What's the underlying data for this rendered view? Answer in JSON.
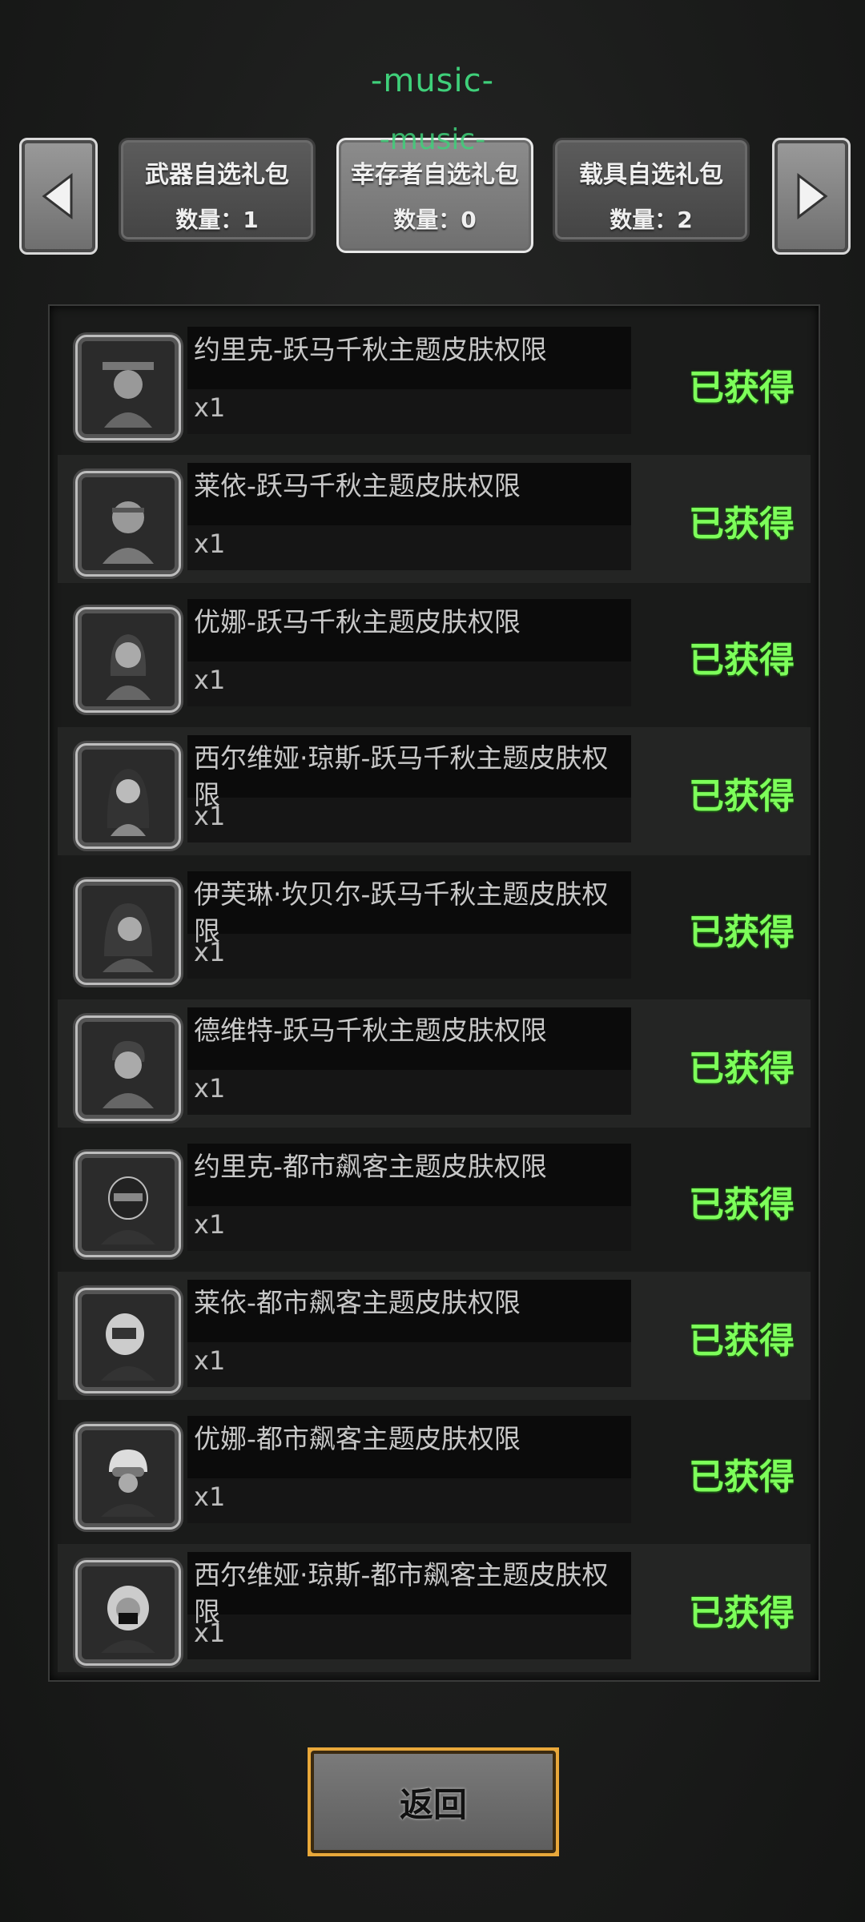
{
  "overlay": {
    "music_top": "-music-",
    "music_over": "-music-"
  },
  "tabs": [
    {
      "title": "武器自选礼包",
      "count": "数量：1"
    },
    {
      "title": "幸存者自选礼包",
      "count": "数量：0"
    },
    {
      "title": "载具自选礼包",
      "count": "数量：2"
    }
  ],
  "items": [
    {
      "name": "约里克-跃马千秋主题皮肤权限",
      "qty": "x1",
      "status": "已获得",
      "portrait": "hat-man-portrait"
    },
    {
      "name": "莱依-跃马千秋主题皮肤权限",
      "qty": "x1",
      "status": "已获得",
      "portrait": "headband-man-portrait"
    },
    {
      "name": "优娜-跃马千秋主题皮肤权限",
      "qty": "x1",
      "status": "已获得",
      "portrait": "woman-portrait"
    },
    {
      "name": "西尔维娅·琼斯-跃马千秋主题皮肤权限",
      "qty": "x1",
      "status": "已获得",
      "portrait": "long-hair-woman-portrait"
    },
    {
      "name": "伊芙琳·坎贝尔-跃马千秋主题皮肤权限",
      "qty": "x1",
      "status": "已获得",
      "portrait": "hooded-woman-portrait"
    },
    {
      "name": "德维特-跃马千秋主题皮肤权限",
      "qty": "x1",
      "status": "已获得",
      "portrait": "man-portrait"
    },
    {
      "name": "约里克-都市飙客主题皮肤权限",
      "qty": "x1",
      "status": "已获得",
      "portrait": "helmet-rider-portrait"
    },
    {
      "name": "莱依-都市飙客主题皮肤权限",
      "qty": "x1",
      "status": "已获得",
      "portrait": "visor-rider-portrait"
    },
    {
      "name": "优娜-都市飙客主题皮肤权限",
      "qty": "x1",
      "status": "已获得",
      "portrait": "goggles-rider-portrait"
    },
    {
      "name": "西尔维娅·琼斯-都市飙客主题皮肤权限",
      "qty": "x1",
      "status": "已获得",
      "portrait": "masked-rider-portrait"
    }
  ],
  "footer": {
    "return_label": "返回"
  },
  "icons": {
    "prev": "triangle-left-icon",
    "next": "triangle-right-icon"
  },
  "colors": {
    "obtained": "#7dff5a",
    "music": "#3fd07a",
    "button_border": "#e9a83a"
  }
}
